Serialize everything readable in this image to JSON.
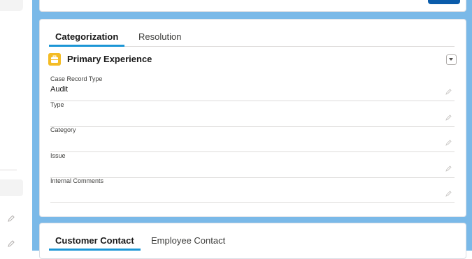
{
  "tabs": [
    {
      "label": "Categorization",
      "active": true
    },
    {
      "label": "Resolution",
      "active": false
    }
  ],
  "section": {
    "title": "Primary Experience",
    "icon": "briefcase-icon"
  },
  "fields": [
    {
      "label": "Case Record Type",
      "value": "Audit"
    },
    {
      "label": "Type",
      "value": ""
    },
    {
      "label": "Category",
      "value": ""
    },
    {
      "label": "Issue",
      "value": ""
    },
    {
      "label": "Internal Comments",
      "value": ""
    }
  ],
  "contact_tabs": [
    {
      "label": "Customer Contact",
      "active": true
    },
    {
      "label": "Employee Contact",
      "active": false
    }
  ],
  "colors": {
    "accent": "#1b96d5",
    "background": "#7ab9e8",
    "brand_button": "#0b5cab",
    "section_icon": "#f4bc25"
  }
}
